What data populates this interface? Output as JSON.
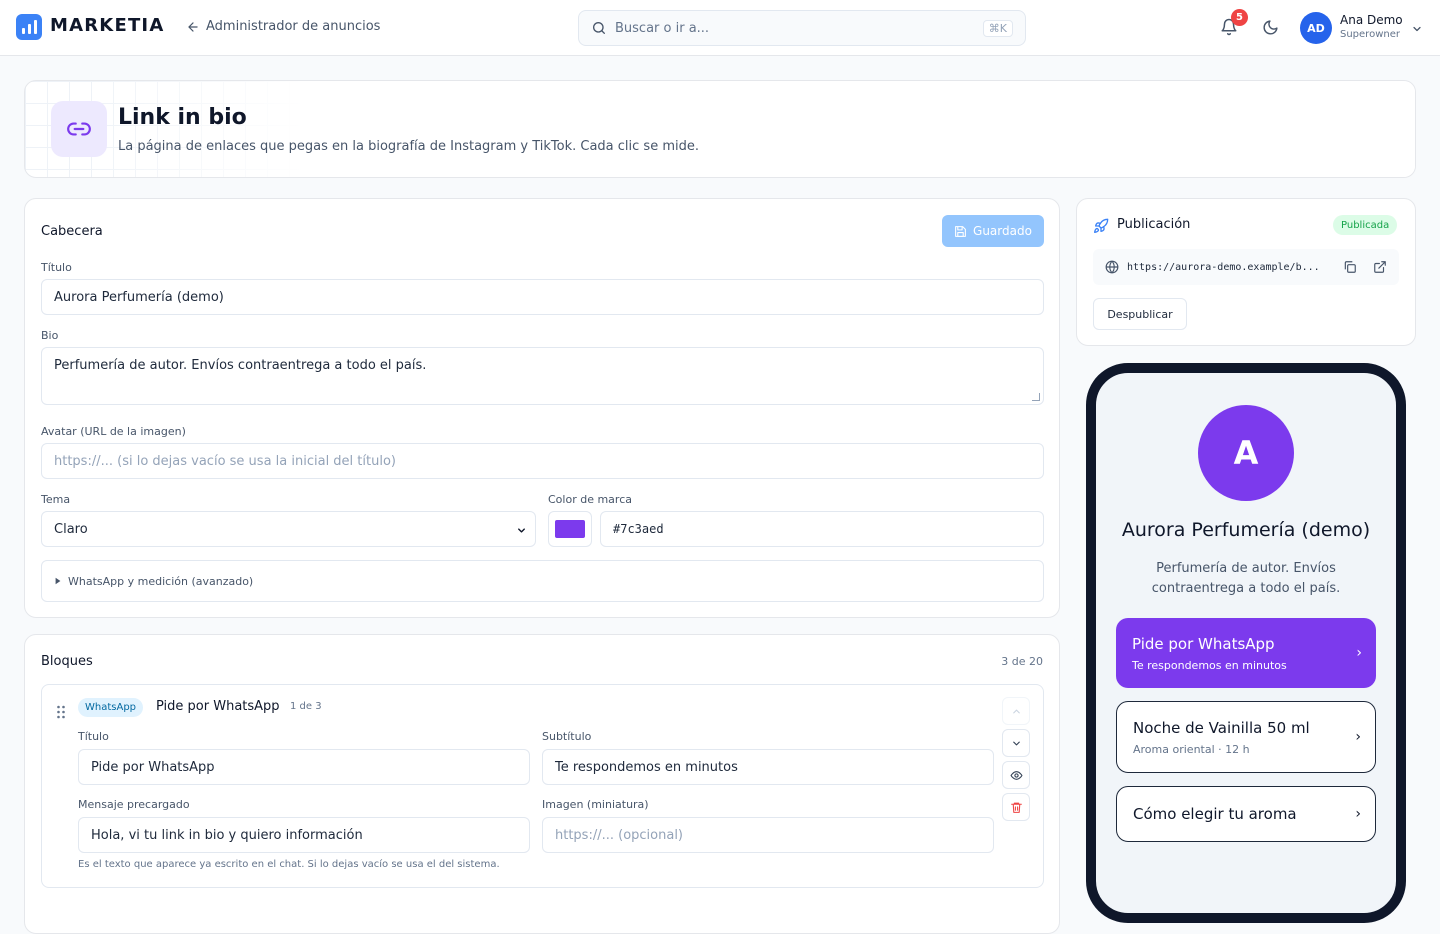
{
  "brand": {
    "name": "MARKETIA"
  },
  "nav": {
    "back_label": "Administrador de anuncios"
  },
  "search": {
    "placeholder": "Buscar o ir a...",
    "shortcut": "⌘K"
  },
  "notifications": {
    "count": "5"
  },
  "user": {
    "initials": "AD",
    "name": "Ana Demo",
    "role": "Superowner"
  },
  "hero": {
    "title": "Link in bio",
    "subtitle": "La página de enlaces que pegas en la biografía de Instagram y TikTok. Cada clic se mide."
  },
  "header_section": {
    "title": "Cabecera",
    "save_label": "Guardado",
    "title_label": "Título",
    "title_value": "Aurora Perfumería (demo)",
    "bio_label": "Bio",
    "bio_value": "Perfumería de autor. Envíos contraentrega a todo el país.",
    "avatar_label": "Avatar (URL de la imagen)",
    "avatar_placeholder": "https://... (si lo dejas vacío se usa la inicial del título)",
    "theme_label": "Tema",
    "theme_value": "Claro",
    "color_label": "Color de marca",
    "color_value": "#7c3aed",
    "advanced_label": "WhatsApp y medición (avanzado)"
  },
  "blocks": {
    "title": "Bloques",
    "count": "3 de 20",
    "items": [
      {
        "type": "WhatsApp",
        "name": "Pide por WhatsApp",
        "index": "1 de 3",
        "title_label": "Título",
        "title_value": "Pide por WhatsApp",
        "subtitle_label": "Subtítulo",
        "subtitle_value": "Te respondemos en minutos",
        "message_label": "Mensaje precargado",
        "message_value": "Hola, vi tu link in bio y quiero información",
        "image_label": "Imagen (miniatura)",
        "image_placeholder": "https://... (opcional)",
        "hint": "Es el texto que aparece ya escrito en el chat. Si lo dejas vacío se usa el del sistema."
      }
    ]
  },
  "publication": {
    "title": "Publicación",
    "status": "Publicada",
    "url": "https://aurora-demo.example/b...",
    "unpublish_label": "Despublicar"
  },
  "preview": {
    "avatar_letter": "A",
    "name": "Aurora Perfumería (demo)",
    "bio": "Perfumería de autor. Envíos contraentrega a todo el país.",
    "links": [
      {
        "title": "Pide por WhatsApp",
        "subtitle": "Te respondemos en minutos"
      },
      {
        "title": "Noche de Vainilla 50 ml",
        "subtitle": "Aroma oriental · 12 h"
      },
      {
        "title": "Cómo elegir tu aroma",
        "subtitle": ""
      }
    ]
  },
  "colors": {
    "brand": "#7c3aed",
    "accent": "#3b82f6",
    "success": "#16a34a",
    "danger": "#ef4444"
  },
  "icons": [
    "chart-bars-icon",
    "arrow-left-icon",
    "search-icon",
    "bell-icon",
    "moon-icon",
    "chevron-down-icon",
    "link-icon",
    "save-icon",
    "rocket-icon",
    "globe-icon",
    "copy-icon",
    "external-link-icon",
    "drag-handle-icon",
    "chevron-up-icon",
    "eye-icon",
    "trash-icon"
  ]
}
